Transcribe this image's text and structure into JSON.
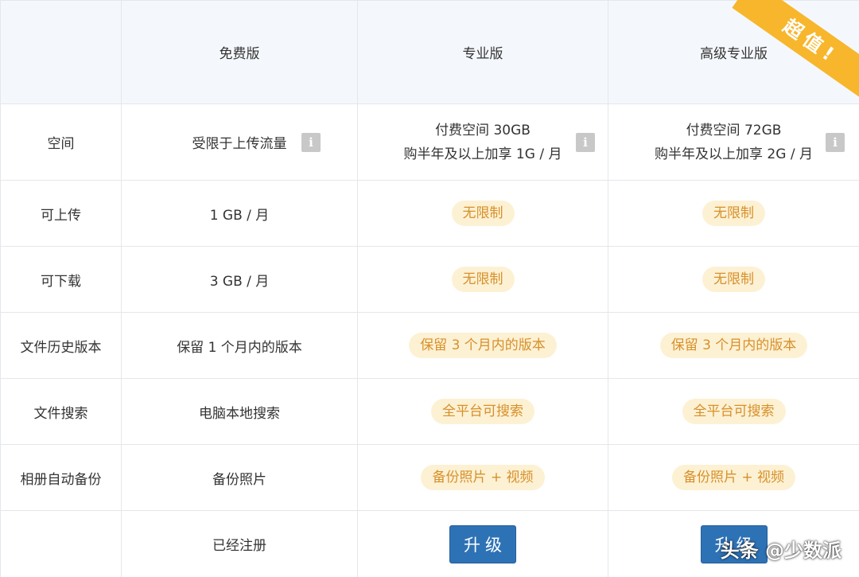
{
  "columns": {
    "free": "免费版",
    "pro": "专业版",
    "premium": "高级专业版"
  },
  "ribbon": "超值!",
  "rows": {
    "space": {
      "label": "空间",
      "free": "受限于上传流量",
      "pro_line1": "付费空间 30GB",
      "pro_line2": "购半年及以上加享 1G / 月",
      "premium_line1": "付费空间 72GB",
      "premium_line2": "购半年及以上加享 2G / 月",
      "info": "i"
    },
    "upload": {
      "label": "可上传",
      "free": "1 GB / 月",
      "pro": "无限制",
      "premium": "无限制"
    },
    "download": {
      "label": "可下载",
      "free": "3 GB / 月",
      "pro": "无限制",
      "premium": "无限制"
    },
    "history": {
      "label": "文件历史版本",
      "free": "保留 1 个月内的版本",
      "pro": "保留 3 个月内的版本",
      "premium": "保留 3 个月内的版本"
    },
    "search": {
      "label": "文件搜索",
      "free": "电脑本地搜索",
      "pro": "全平台可搜索",
      "premium": "全平台可搜索"
    },
    "backup": {
      "label": "相册自动备份",
      "free": "备份照片",
      "pro": "备份照片 + 视频",
      "premium": "备份照片 + 视频"
    },
    "action": {
      "free": "已经注册",
      "pro_button": "升级",
      "premium_button": "升级"
    }
  },
  "watermark": "头条 @少数派",
  "colors": {
    "header_bg": "#f4f8fc",
    "pill_bg": "#fdf1d4",
    "pill_text": "#d7902a",
    "button": "#2e72b6",
    "ribbon": "#f7b62c",
    "info_icon": "#c8c8c8"
  }
}
